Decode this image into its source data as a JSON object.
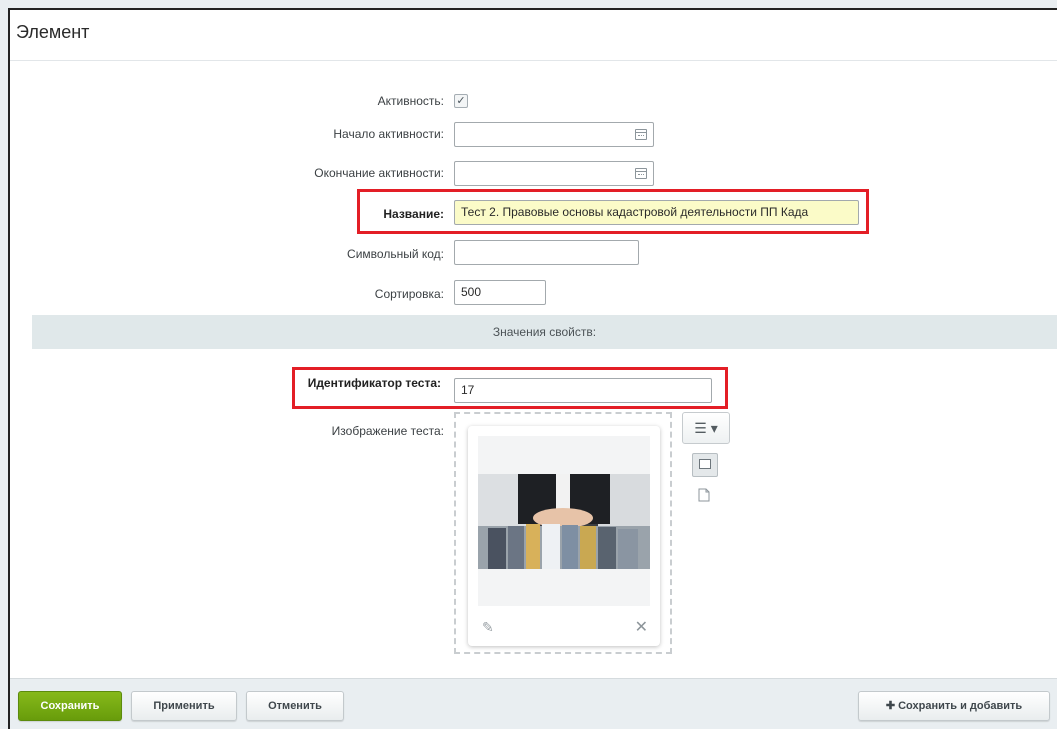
{
  "window": {
    "title": "Элемент"
  },
  "fields": {
    "active_label": "Активность:",
    "active_checked": true,
    "active_check_glyph": "✓",
    "start_label": "Начало активности:",
    "start_value": "",
    "end_label": "Окончание активности:",
    "end_value": "",
    "name_label": "Название:",
    "name_value": "Тест 2. Правовые основы кадастровой деятельности ПП Када",
    "code_label": "Символьный код:",
    "code_value": "",
    "sort_label": "Сортировка:",
    "sort_value": "500"
  },
  "properties": {
    "section_title": "Значения свойств:",
    "test_id_label": "Идентификатор теста:",
    "test_id_value": "17",
    "test_image_label": "Изображение теста:",
    "menu_icon": "☰ ▾",
    "edit_icon": "✎",
    "delete_icon": "✕"
  },
  "footer": {
    "save": "Сохранить",
    "apply": "Применить",
    "cancel": "Отменить",
    "save_add": "Сохранить и добавить",
    "save_add_icon": "✚"
  },
  "colors": {
    "primary_green": "#6fa312",
    "highlight_red": "#e31e26",
    "name_field_bg": "#fbfbc8",
    "section_bg": "#e0e8ea"
  }
}
